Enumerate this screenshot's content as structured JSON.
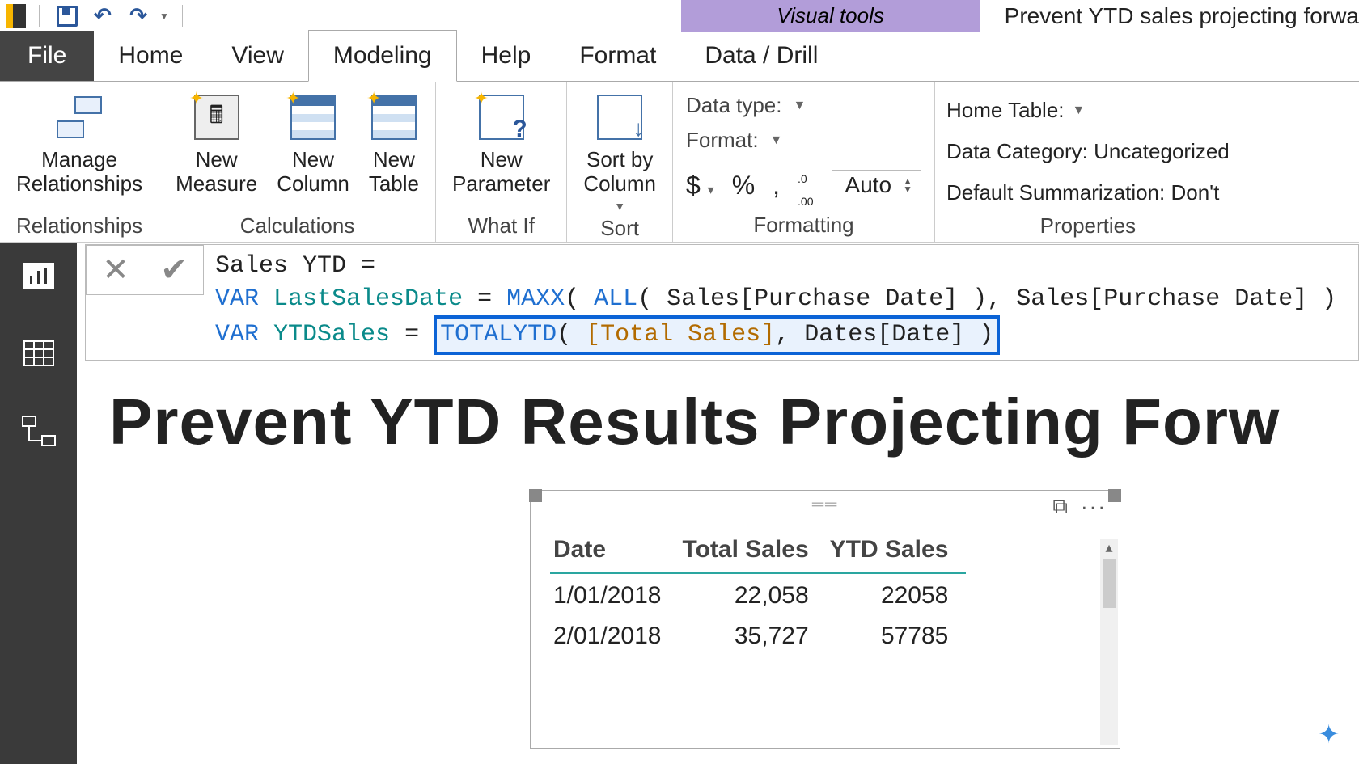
{
  "titlebar": {
    "contextual_tab": "Visual tools",
    "doc_title": "Prevent YTD sales projecting forwa"
  },
  "tabs": {
    "file": "File",
    "home": "Home",
    "view": "View",
    "modeling": "Modeling",
    "help": "Help",
    "format": "Format",
    "data_drill": "Data / Drill"
  },
  "ribbon": {
    "relationships": {
      "group": "Relationships",
      "manage": "Manage\nRelationships"
    },
    "calculations": {
      "group": "Calculations",
      "new_measure": "New\nMeasure",
      "new_column": "New\nColumn",
      "new_table": "New\nTable"
    },
    "whatif": {
      "group": "What If",
      "new_param": "New\nParameter"
    },
    "sort": {
      "group": "Sort",
      "sort_by": "Sort by\nColumn"
    },
    "formatting": {
      "group": "Formatting",
      "data_type": "Data type:",
      "format": "Format:",
      "dollar": "$",
      "percent": "%",
      "comma": ",",
      "decimals": ".00",
      "auto": "Auto"
    },
    "properties": {
      "group": "Properties",
      "home_table": "Home Table:",
      "data_category": "Data Category: Uncategorized",
      "default_summarization": "Default Summarization: Don't"
    }
  },
  "formula": {
    "line1_text": "Sales YTD =",
    "var": "VAR",
    "lastSalesDate": "LastSalesDate",
    "eq": " = ",
    "maxx": "MAXX",
    "all": "ALL",
    "sales_pd": "Sales[Purchase Date]",
    "ytdSales": "YTDSales",
    "totalytd": "TOTALYTD",
    "total_sales": "[Total Sales]",
    "dates_date": "Dates[Date]"
  },
  "page_title": "Prevent YTD Results Projecting Forw",
  "table": {
    "headers": {
      "date": "Date",
      "total": "Total Sales",
      "ytd": "YTD Sales"
    },
    "rows": [
      {
        "date": "1/01/2018",
        "total": "22,058",
        "ytd": "22058"
      },
      {
        "date": "2/01/2018",
        "total": "35,727",
        "ytd": "57785"
      }
    ],
    "more": "···"
  }
}
